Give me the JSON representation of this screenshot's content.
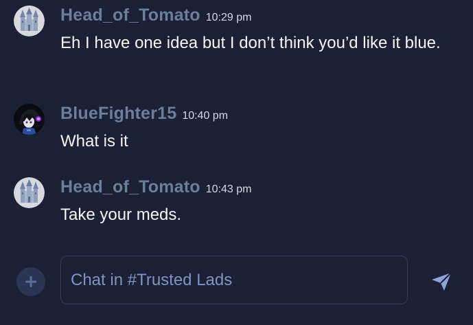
{
  "messages": [
    {
      "author": "Head_of_Tomato",
      "time": "10:29 pm",
      "text": "Eh I have one idea but I don’t think you’d like it blue.",
      "avatar": "castle-avatar-icon"
    },
    {
      "author": "BlueFighter15",
      "time": "10:40 pm",
      "text": "What is it",
      "avatar": "character-avatar-icon"
    },
    {
      "author": "Head_of_Tomato",
      "time": "10:43 pm",
      "text": "Take your meds.",
      "avatar": "castle-avatar-icon"
    }
  ],
  "composer": {
    "placeholder": "Chat in #Trusted Lads",
    "value": "",
    "add_icon": "plus-icon",
    "send_icon": "paper-plane-icon"
  },
  "colors": {
    "background": "#1b2134",
    "author": "#6b7f98",
    "timestamp": "#d3d9e4",
    "message_text": "#f4f6fa",
    "placeholder": "#7f93c4",
    "accent": "#8ea2d8"
  }
}
